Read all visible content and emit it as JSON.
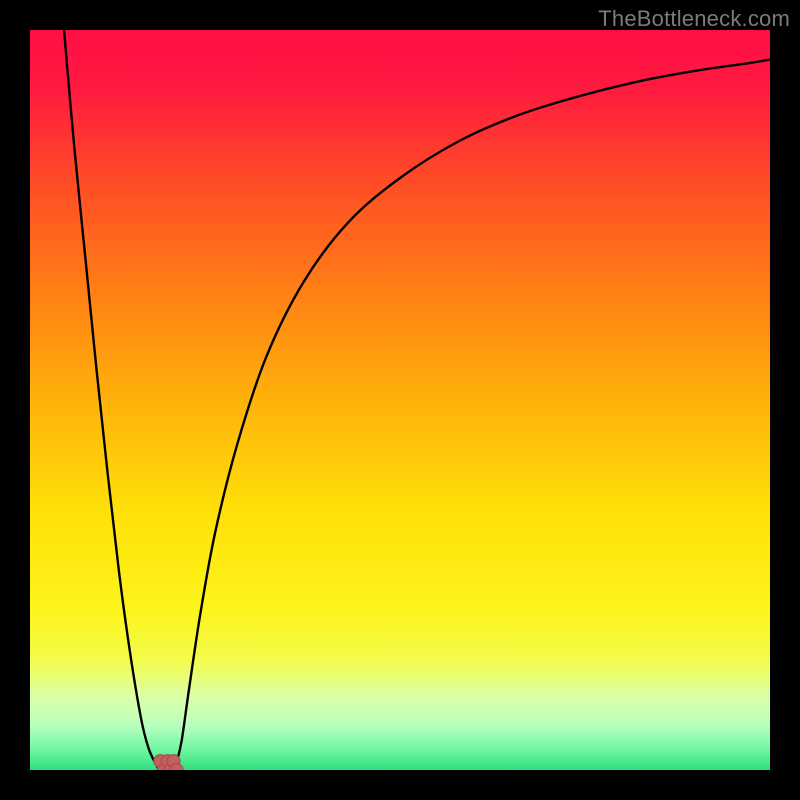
{
  "attribution": "TheBottleneck.com",
  "colors": {
    "frame": "#000000",
    "gradient_stops": [
      {
        "offset": 0.0,
        "color": "#ff0e46"
      },
      {
        "offset": 0.08,
        "color": "#ff1a3f"
      },
      {
        "offset": 0.2,
        "color": "#ff4a27"
      },
      {
        "offset": 0.35,
        "color": "#ff7e15"
      },
      {
        "offset": 0.5,
        "color": "#ffb20a"
      },
      {
        "offset": 0.65,
        "color": "#ffe009"
      },
      {
        "offset": 0.78,
        "color": "#fdf41a"
      },
      {
        "offset": 0.85,
        "color": "#f3fc4a"
      },
      {
        "offset": 0.9,
        "color": "#ddffa5"
      },
      {
        "offset": 0.94,
        "color": "#b8ffc0"
      },
      {
        "offset": 0.97,
        "color": "#75f8a5"
      },
      {
        "offset": 1.0,
        "color": "#2fe07d"
      }
    ],
    "curve": "#000000",
    "marker_fill": "#c45f5f",
    "marker_stroke": "#a74a4a"
  },
  "chart_data": {
    "type": "line",
    "x": [
      0.046,
      0.06,
      0.075,
      0.09,
      0.105,
      0.12,
      0.135,
      0.15,
      0.16,
      0.17,
      0.176,
      0.181,
      0.186,
      0.19,
      0.194,
      0.198,
      0.205,
      0.215,
      0.23,
      0.25,
      0.28,
      0.32,
      0.37,
      0.43,
      0.5,
      0.58,
      0.66,
      0.74,
      0.82,
      0.9,
      0.97,
      1.0
    ],
    "y": [
      1.0,
      0.84,
      0.69,
      0.54,
      0.4,
      0.27,
      0.16,
      0.07,
      0.03,
      0.008,
      0.0,
      0.012,
      0.0,
      0.012,
      0.0,
      0.01,
      0.04,
      0.11,
      0.21,
      0.32,
      0.44,
      0.56,
      0.66,
      0.74,
      0.8,
      0.85,
      0.885,
      0.91,
      0.93,
      0.945,
      0.955,
      0.96
    ],
    "markers": [
      {
        "x": 0.176,
        "y": 0.012
      },
      {
        "x": 0.181,
        "y": 0.0
      },
      {
        "x": 0.186,
        "y": 0.012
      },
      {
        "x": 0.19,
        "y": 0.0
      },
      {
        "x": 0.194,
        "y": 0.012
      },
      {
        "x": 0.198,
        "y": 0.0
      }
    ],
    "xlabel": "",
    "ylabel": "",
    "title": "",
    "xlim": [
      0,
      1
    ],
    "ylim": [
      0,
      1
    ]
  }
}
